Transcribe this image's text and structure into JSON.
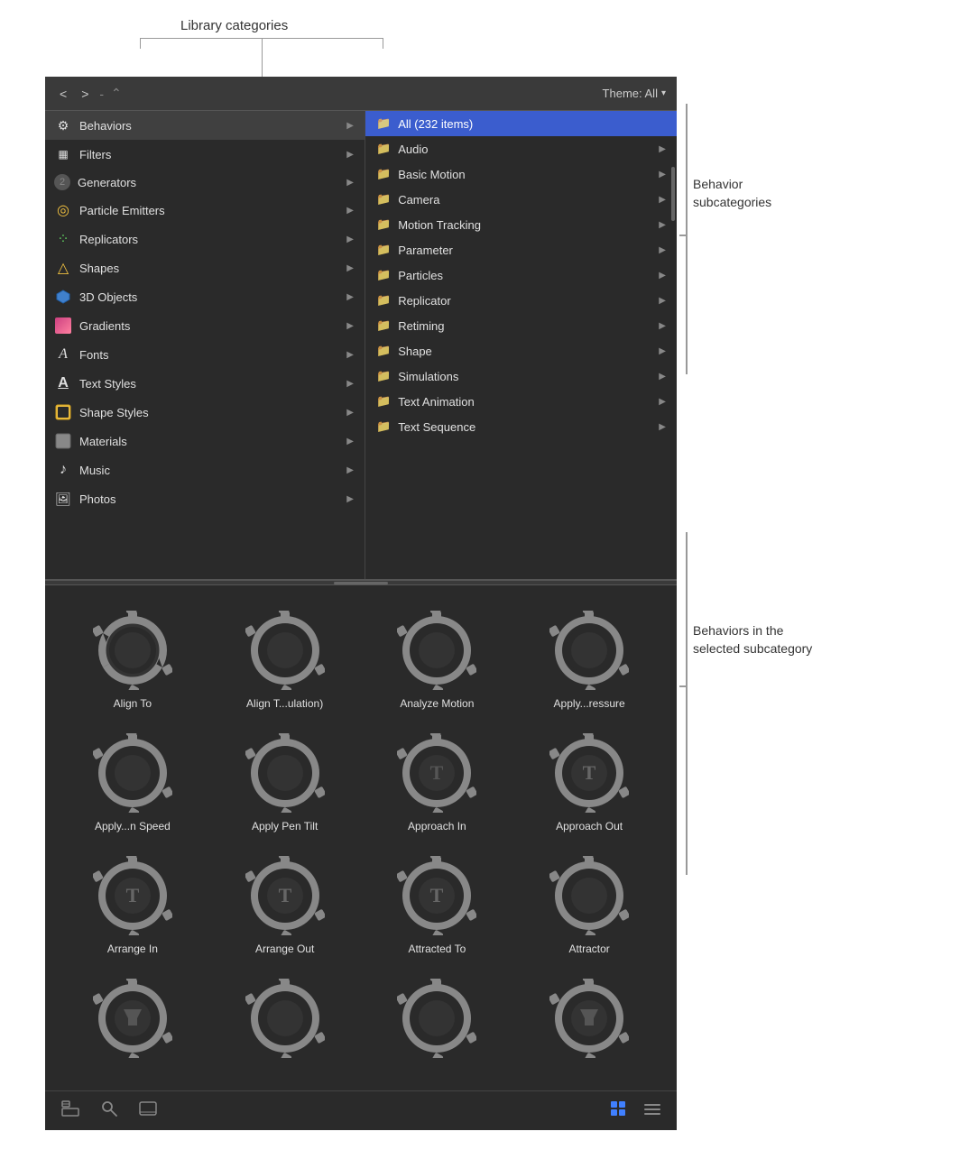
{
  "annotations": {
    "top_label": "Library categories",
    "right_top_label": "Behavior\nsubcategories",
    "right_bottom_label": "Behaviors in the\nselected subcategory"
  },
  "header": {
    "theme_label": "Theme: All",
    "nav": {
      "back": "<",
      "forward": ">",
      "dash": "-",
      "arrows": "⌃"
    }
  },
  "sidebar": {
    "items": [
      {
        "id": "behaviors",
        "icon": "⚙",
        "label": "Behaviors",
        "icon_color": "#aaa",
        "selected": true
      },
      {
        "id": "filters",
        "icon": "▦",
        "label": "Filters",
        "icon_color": "#aaa"
      },
      {
        "id": "generators",
        "icon": "②",
        "label": "Generators",
        "icon_color": "#aaa"
      },
      {
        "id": "particle-emitters",
        "icon": "◎",
        "label": "Particle Emitters",
        "icon_color": "#f0c040"
      },
      {
        "id": "replicators",
        "icon": "⋮",
        "label": "Replicators",
        "icon_color": "#60cc60"
      },
      {
        "id": "shapes",
        "icon": "△",
        "label": "Shapes",
        "icon_color": "#f0c040"
      },
      {
        "id": "3d-objects",
        "icon": "⬡",
        "label": "3D Objects",
        "icon_color": "#4080cc"
      },
      {
        "id": "gradients",
        "icon": "▨",
        "label": "Gradients",
        "icon_color": "#cc4080"
      },
      {
        "id": "fonts",
        "icon": "A",
        "label": "Fonts",
        "icon_color": "#e0e0e0"
      },
      {
        "id": "text-styles",
        "icon": "A̲",
        "label": "Text Styles",
        "icon_color": "#e0e0e0"
      },
      {
        "id": "shape-styles",
        "icon": "◻",
        "label": "Shape Styles",
        "icon_color": "#f0c040"
      },
      {
        "id": "materials",
        "icon": "◻",
        "label": "Materials",
        "icon_color": "#888"
      },
      {
        "id": "music",
        "icon": "♪",
        "label": "Music",
        "icon_color": "#e0e0e0"
      },
      {
        "id": "photos",
        "icon": "🏔",
        "label": "Photos",
        "icon_color": "#aaa"
      }
    ]
  },
  "subcategories": {
    "items": [
      {
        "id": "all",
        "label": "All (232 items)",
        "selected": true
      },
      {
        "id": "audio",
        "label": "Audio"
      },
      {
        "id": "basic-motion",
        "label": "Basic Motion"
      },
      {
        "id": "camera",
        "label": "Camera"
      },
      {
        "id": "motion-tracking",
        "label": "Motion Tracking"
      },
      {
        "id": "parameter",
        "label": "Parameter"
      },
      {
        "id": "particles",
        "label": "Particles"
      },
      {
        "id": "replicator",
        "label": "Replicator"
      },
      {
        "id": "retiming",
        "label": "Retiming"
      },
      {
        "id": "shape",
        "label": "Shape"
      },
      {
        "id": "simulations",
        "label": "Simulations"
      },
      {
        "id": "text-animation",
        "label": "Text Animation"
      },
      {
        "id": "text-sequence",
        "label": "Text Sequence"
      }
    ]
  },
  "grid": {
    "items": [
      {
        "id": "align-to",
        "label": "Align To",
        "inner": "none"
      },
      {
        "id": "align-t-ulation",
        "label": "Align T...ulation)",
        "inner": "none"
      },
      {
        "id": "analyze-motion",
        "label": "Analyze Motion",
        "inner": "none"
      },
      {
        "id": "apply-ressure",
        "label": "Apply...ressure",
        "inner": "none"
      },
      {
        "id": "apply-n-speed",
        "label": "Apply...n Speed",
        "inner": "none"
      },
      {
        "id": "apply-pen-tilt",
        "label": "Apply Pen Tilt",
        "inner": "none"
      },
      {
        "id": "approach-in",
        "label": "Approach In",
        "inner": "T"
      },
      {
        "id": "approach-out",
        "label": "Approach Out",
        "inner": "T"
      },
      {
        "id": "arrange-in",
        "label": "Arrange In",
        "inner": "T"
      },
      {
        "id": "arrange-out",
        "label": "Arrange Out",
        "inner": "T"
      },
      {
        "id": "attracted-to",
        "label": "Attracted To",
        "inner": "T"
      },
      {
        "id": "attractor",
        "label": "Attractor",
        "inner": "none"
      },
      {
        "id": "item-13",
        "label": "",
        "inner": "funnel"
      },
      {
        "id": "item-14",
        "label": "",
        "inner": "none"
      },
      {
        "id": "item-15",
        "label": "",
        "inner": "none"
      },
      {
        "id": "item-16",
        "label": "",
        "inner": "funnel"
      }
    ]
  },
  "toolbar": {
    "import_label": "Import",
    "search_label": "Search",
    "preview_label": "Preview",
    "grid_label": "Grid View",
    "list_label": "List View"
  }
}
